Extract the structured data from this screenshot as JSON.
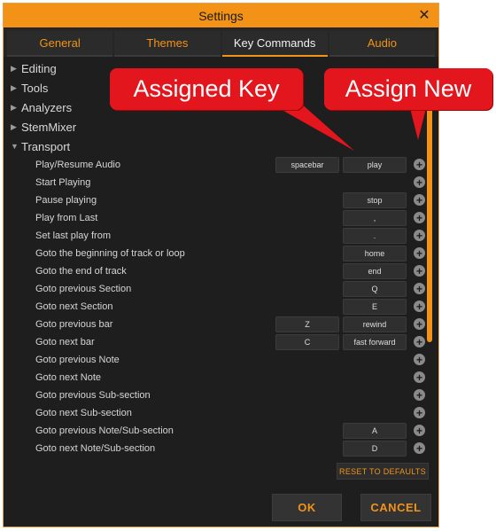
{
  "window": {
    "title": "Settings",
    "close_glyph": "✕"
  },
  "tabs": [
    {
      "label": "General",
      "active": false
    },
    {
      "label": "Themes",
      "active": false
    },
    {
      "label": "Key Commands",
      "active": true
    },
    {
      "label": "Audio",
      "active": false
    }
  ],
  "groups": [
    {
      "label": "Editing",
      "expanded": false
    },
    {
      "label": "Tools",
      "expanded": false
    },
    {
      "label": "Analyzers",
      "expanded": false
    },
    {
      "label": "StemMixer",
      "expanded": false
    },
    {
      "label": "Transport",
      "expanded": true
    }
  ],
  "commands": [
    {
      "label": "Play/Resume Audio",
      "key1": "spacebar",
      "key2": "play"
    },
    {
      "label": "Start Playing",
      "key1": "",
      "key2": ""
    },
    {
      "label": "Pause playing",
      "key1": "",
      "key2": "stop"
    },
    {
      "label": "Play from Last",
      "key1": "",
      "key2": ","
    },
    {
      "label": "Set last play from",
      "key1": "",
      "key2": "."
    },
    {
      "label": "Goto the beginning of track or loop",
      "key1": "",
      "key2": "home"
    },
    {
      "label": "Goto the end of track",
      "key1": "",
      "key2": "end"
    },
    {
      "label": "Goto previous Section",
      "key1": "",
      "key2": "Q"
    },
    {
      "label": "Goto next Section",
      "key1": "",
      "key2": "E"
    },
    {
      "label": "Goto previous bar",
      "key1": "Z",
      "key2": "rewind"
    },
    {
      "label": "Goto next bar",
      "key1": "C",
      "key2": "fast forward"
    },
    {
      "label": "Goto previous Note",
      "key1": "",
      "key2": ""
    },
    {
      "label": "Goto next Note",
      "key1": "",
      "key2": ""
    },
    {
      "label": "Goto previous Sub-section",
      "key1": "",
      "key2": ""
    },
    {
      "label": "Goto next Sub-section",
      "key1": "",
      "key2": ""
    },
    {
      "label": "Goto previous Note/Sub-section",
      "key1": "",
      "key2": "A"
    },
    {
      "label": "Goto next Note/Sub-section",
      "key1": "",
      "key2": "D"
    }
  ],
  "buttons": {
    "reset": "RESET TO DEFAULTS",
    "ok": "OK",
    "cancel": "CANCEL"
  },
  "annotations": {
    "assigned_key": "Assigned Key",
    "assign_new": "Assign New"
  },
  "icons": {
    "collapsed": "triangle-right-icon",
    "expanded": "triangle-down-icon",
    "add": "plus-circle-icon",
    "close": "close-icon"
  },
  "colors": {
    "accent": "#f29318",
    "background": "#1e1e1e",
    "callout": "#e3161e"
  }
}
